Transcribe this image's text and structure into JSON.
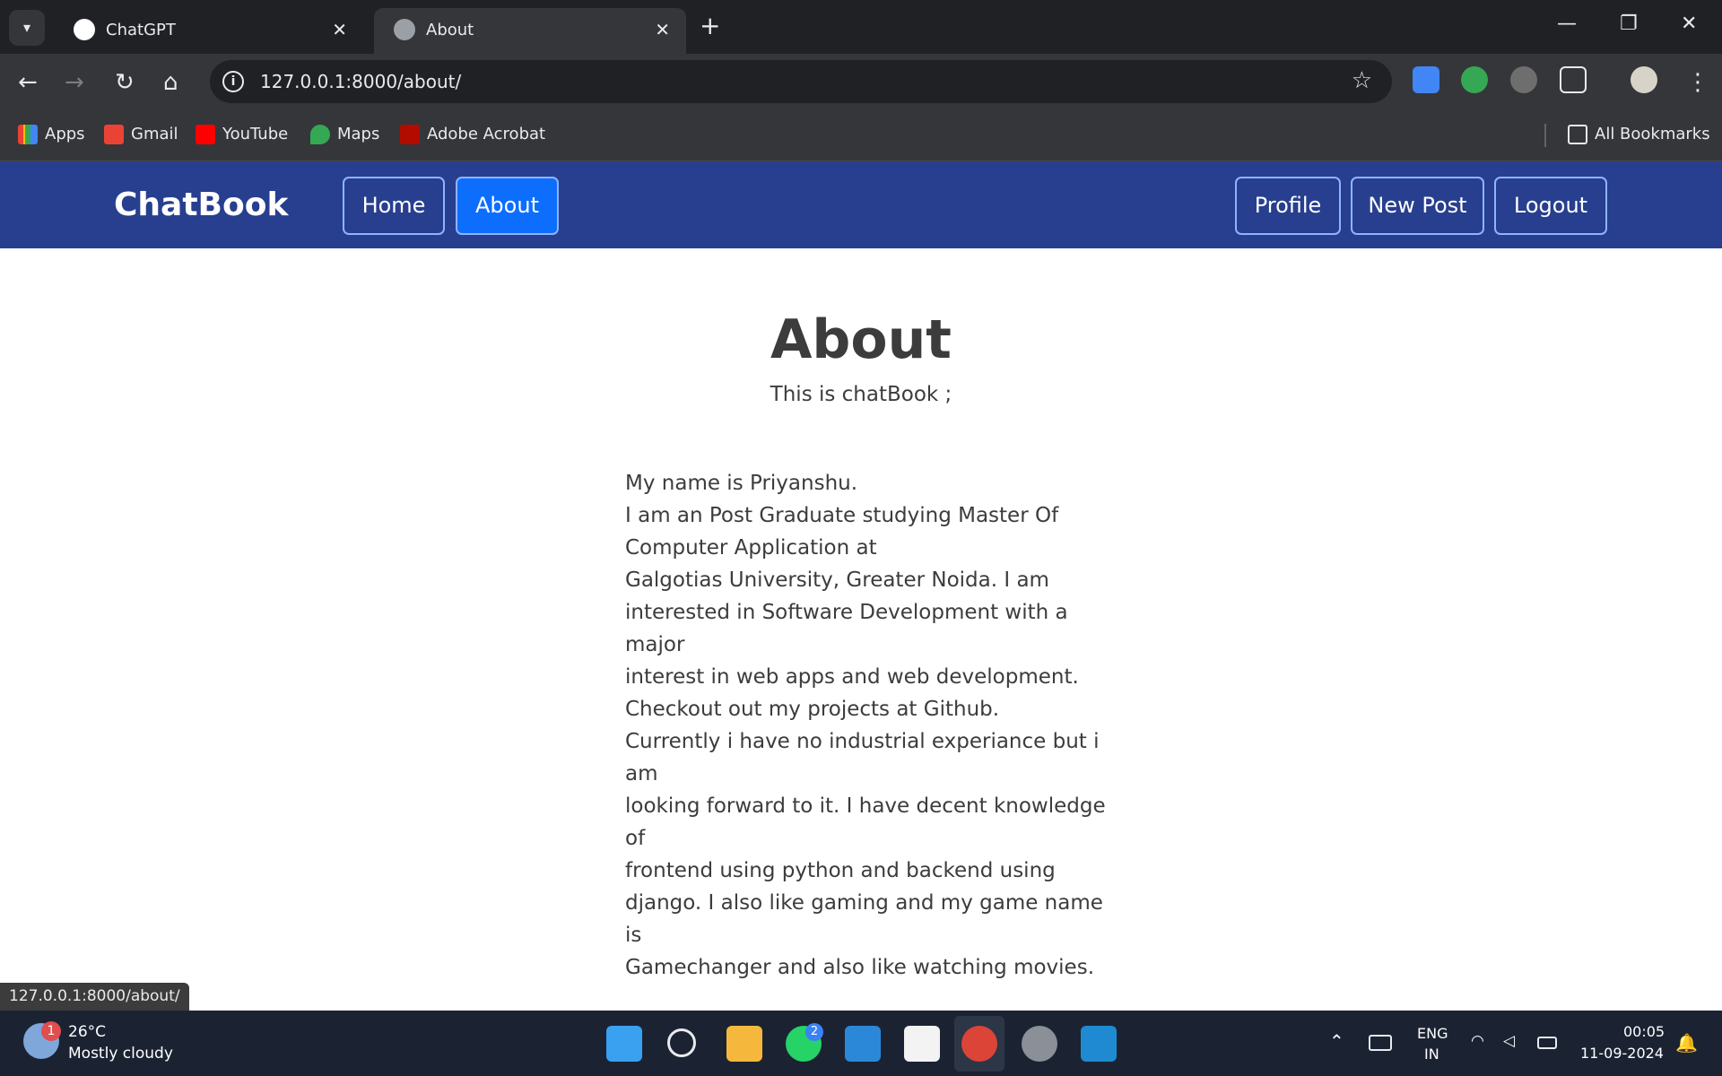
{
  "browser": {
    "tabs": [
      {
        "title": "ChatGPT"
      },
      {
        "title": "About"
      }
    ],
    "url": "127.0.0.1:8000/about/",
    "bookmarks": [
      {
        "label": "Apps"
      },
      {
        "label": "Gmail"
      },
      {
        "label": "YouTube"
      },
      {
        "label": "Maps"
      },
      {
        "label": "Adobe Acrobat"
      }
    ],
    "all_bookmarks_label": "All Bookmarks"
  },
  "navbar": {
    "brand": "ChatBook",
    "links_left": [
      "Home",
      "About"
    ],
    "links_right": [
      "Profile",
      "New Post",
      "Logout"
    ]
  },
  "page": {
    "title": "About",
    "subtitle": "This is chatBook ;",
    "para1": [
      "My name is Priyanshu.",
      "I am an Post Graduate studying Master Of",
      "Computer Application at",
      "Galgotias University, Greater Noida. I am",
      "interested in Software Development with a major",
      "interest in web apps and web development.",
      "Checkout out my projects at Github."
    ],
    "para2": [
      "Currently i have no industrial experiance but i am",
      "looking forward to it. I have decent knowledge of",
      "frontend using python and backend using",
      "django. I also like gaming and my game name is",
      "Gamechanger and also like watching movies."
    ]
  },
  "status_url": "127.0.0.1:8000/about/",
  "taskbar": {
    "weather_temp": "26°C",
    "weather_desc": "Mostly cloudy",
    "weather_badge": "1",
    "whatsapp_badge": "2",
    "lang_top": "ENG",
    "lang_bottom": "IN",
    "time": "00:05",
    "date": "11-09-2024"
  },
  "colors": {
    "navbar_bg": "#273f8e",
    "active_link_bg": "#0d6efd",
    "nav_border": "#8fb4ff"
  }
}
